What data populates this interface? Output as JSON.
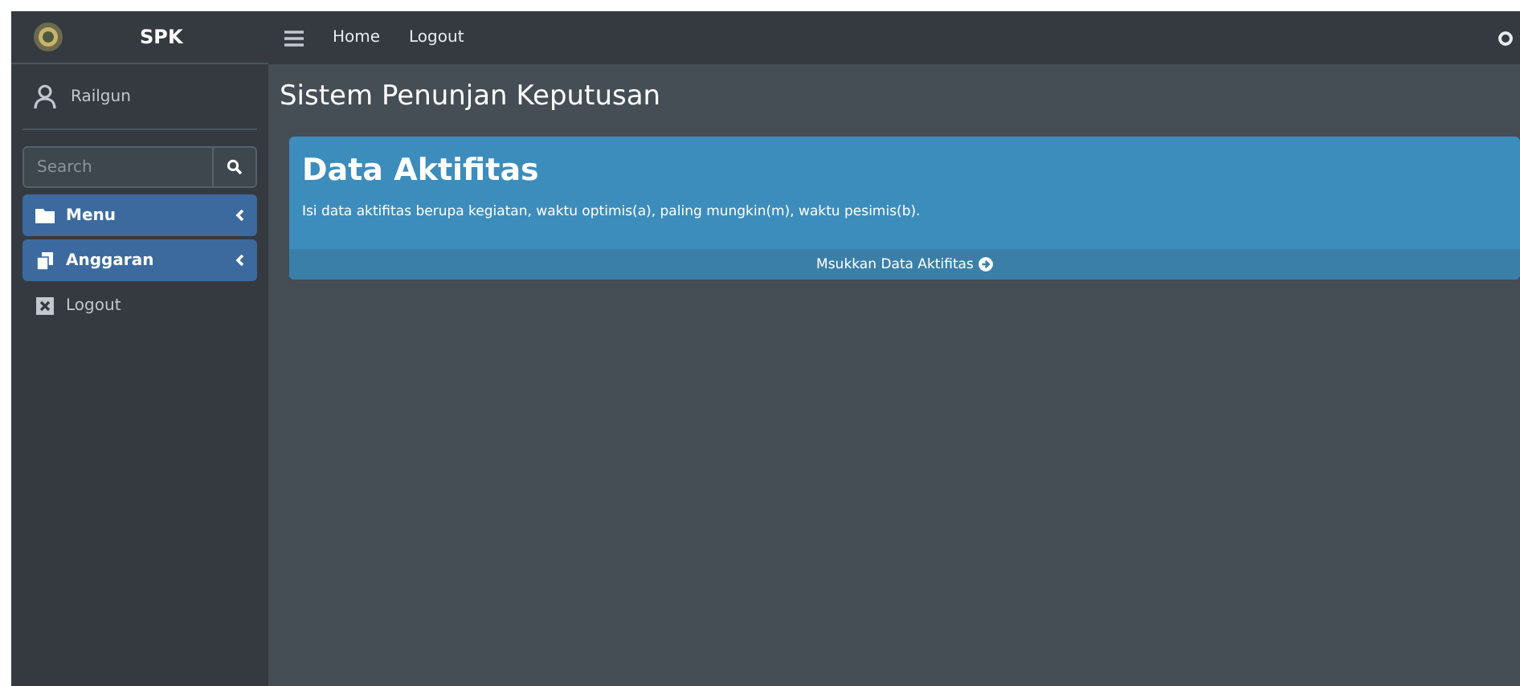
{
  "brand": {
    "title": "SPK"
  },
  "navbar": {
    "links": [
      "Home",
      "Logout"
    ]
  },
  "user": {
    "name": "Railgun"
  },
  "search": {
    "placeholder": "Search"
  },
  "sidebar": {
    "items": [
      {
        "label": "Menu",
        "kind": "folder",
        "selected": true,
        "expandable": true
      },
      {
        "label": "Anggaran",
        "kind": "copy",
        "selected": true,
        "expandable": true
      },
      {
        "label": "Logout",
        "kind": "close",
        "selected": false,
        "expandable": false
      }
    ]
  },
  "page_title": "Sistem Penunjan Keputusan",
  "card": {
    "title": "Data Aktifitas",
    "text": "Isi data aktifitas berupa kegiatan, waktu optimis(a), paling mungkin(m), waktu pesimis(b).",
    "footer_link": "Msukkan Data Aktifitas"
  }
}
